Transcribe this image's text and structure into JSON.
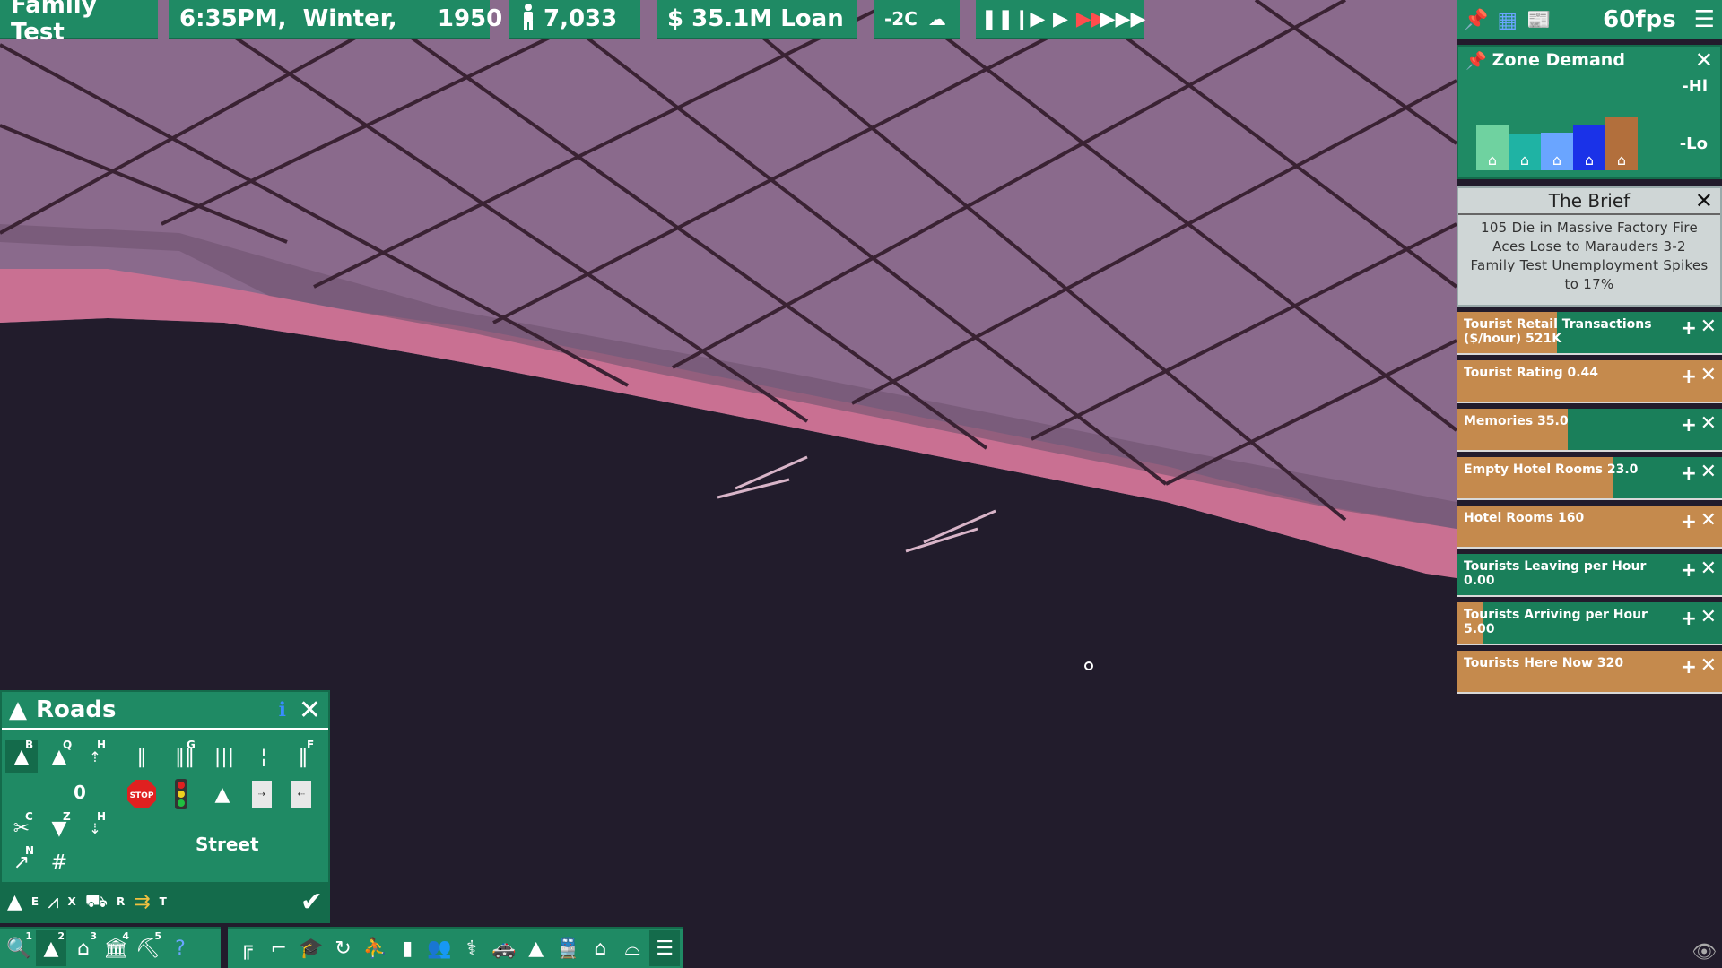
{
  "topbar": {
    "city_name": "Family Test",
    "datetime": "6:35PM,  Winter,     1950",
    "population": "7,033",
    "money": "$ 35.1M Loan",
    "temperature": "-2C",
    "fps": "60fps"
  },
  "zone_demand": {
    "title": "Zone Demand",
    "hi_label": "-Hi",
    "lo_label": "-Lo",
    "bars": [
      {
        "zone": "residential-low",
        "color": "#6fd2a0",
        "level": 0.3
      },
      {
        "zone": "residential-high",
        "color": "#1fb3a4",
        "level": 0.2
      },
      {
        "zone": "retail",
        "color": "#6aa5ff",
        "level": 0.22
      },
      {
        "zone": "office",
        "color": "#1a32e8",
        "level": 0.3
      },
      {
        "zone": "industrial",
        "color": "#b26f3c",
        "level": 0.4
      }
    ]
  },
  "brief": {
    "title": "The Brief",
    "lines": [
      "105 Die in Massive Factory Fire",
      "Aces Lose to Marauders 3-2",
      "Family Test Unemployment Spikes to 17%"
    ]
  },
  "stats": [
    {
      "label": "Tourist Retail Transactions ($/hour) 521K",
      "fill": 0.38
    },
    {
      "label": "Tourist Rating 0.44",
      "fill": 1.0
    },
    {
      "label": "Memories 35.0",
      "fill": 0.42
    },
    {
      "label": "Empty Hotel Rooms 23.0",
      "fill": 0.59
    },
    {
      "label": "Hotel Rooms 160",
      "fill": 1.0
    },
    {
      "label": "Tourists Leaving per Hour 0.00",
      "fill": 0.0
    },
    {
      "label": "Tourists Arriving per Hour 5.00",
      "fill": 0.1
    },
    {
      "label": "Tourists Here Now 320",
      "fill": 1.0
    }
  ],
  "roads": {
    "title": "Roads",
    "count": "0",
    "selected_type": "Street",
    "stop_label": "STOP",
    "hotkeys": {
      "b": "B",
      "q": "Q",
      "h1": "H",
      "g": "G",
      "f": "F",
      "c": "C",
      "z": "Z",
      "h2": "H",
      "n": "N",
      "e": "E",
      "x": "X",
      "r": "R",
      "t": "T"
    }
  },
  "bottombar": {
    "nums": [
      "1",
      "2",
      "3",
      "4",
      "5"
    ]
  }
}
